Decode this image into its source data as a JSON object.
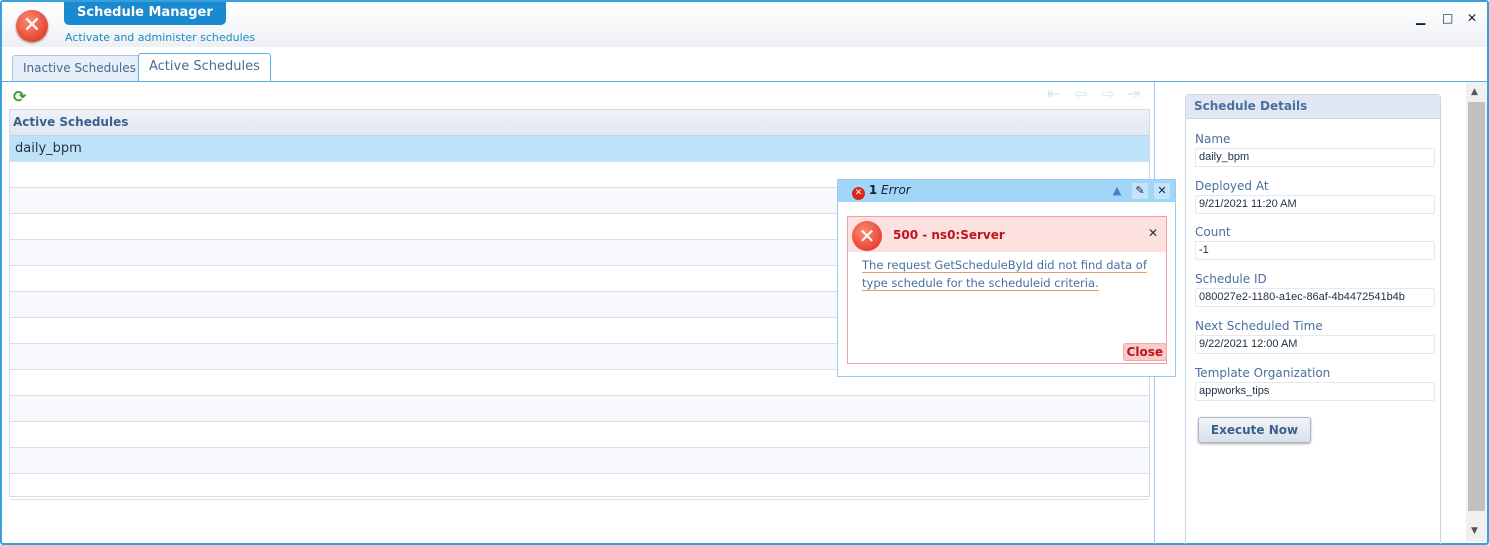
{
  "header": {
    "title": "Schedule Manager",
    "subtitle": "Activate and administer schedules",
    "minimize": "▁",
    "maximize": "□",
    "close": "✕"
  },
  "tabs": [
    {
      "label": "Inactive Schedules"
    },
    {
      "label": "Active Schedules",
      "active": true
    }
  ],
  "grid": {
    "header": "Active Schedules",
    "rows": [
      "daily_bpm",
      "",
      "",
      "",
      "",
      "",
      "",
      "",
      "",
      "",
      "",
      "",
      "",
      ""
    ],
    "selected_index": 0
  },
  "details": {
    "title": "Schedule Details",
    "fields": [
      {
        "label": "Name",
        "value": "daily_bpm"
      },
      {
        "label": "Deployed At",
        "value": "9/21/2021 11:20 AM"
      },
      {
        "label": "Count",
        "value": "-1"
      },
      {
        "label": "Schedule ID",
        "value": "080027e2-1180-a1ec-86af-4b4472541b4b"
      },
      {
        "label": "Next Scheduled Time",
        "value": "9/22/2021 12:00 AM"
      },
      {
        "label": "Template Organization",
        "value": "appworks_tips"
      }
    ],
    "execute_label": "Execute Now"
  },
  "error_popup": {
    "count": "1",
    "title": "Error",
    "error_title": "500 - ns0:Server",
    "message_line1": "The request GetScheduleById did not find data of",
    "message_line2": "type schedule for the scheduleid criteria.",
    "close_label": "Close"
  },
  "colors": {
    "accent": "#1a8ad0",
    "error": "#c0141a",
    "selected_row": "#bee3f9"
  }
}
